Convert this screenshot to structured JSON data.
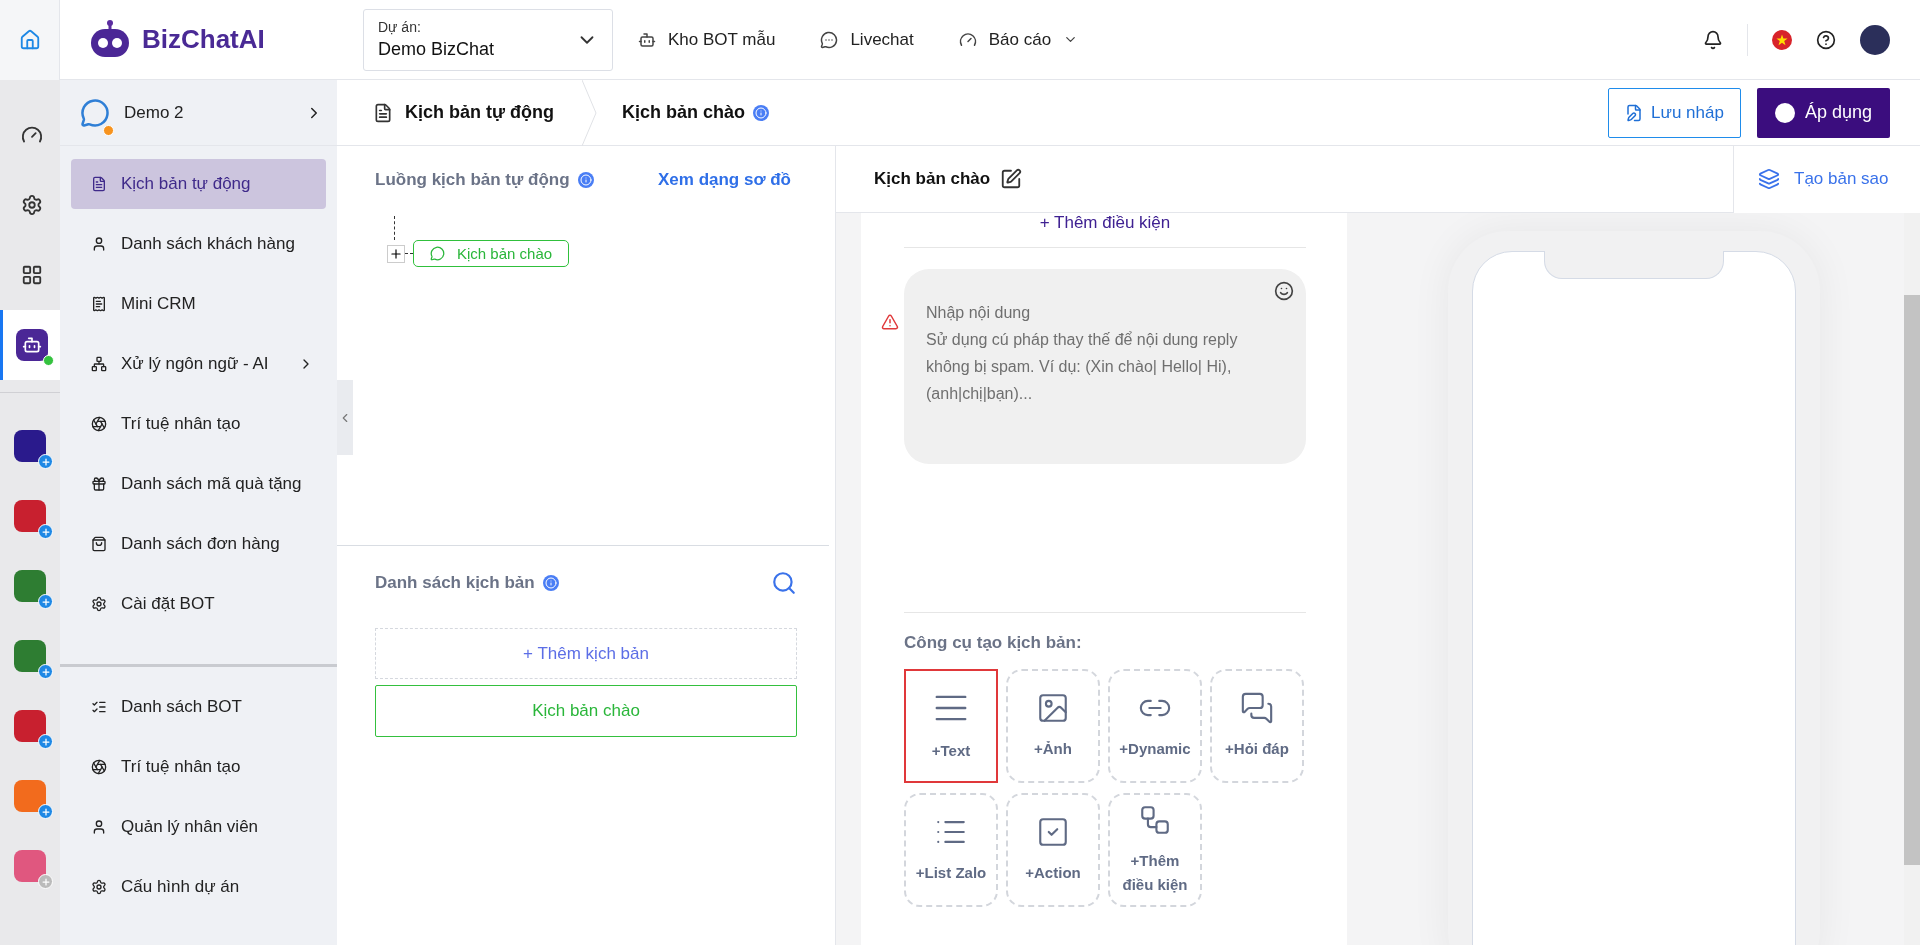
{
  "topbar": {
    "brand": "BizChatAI",
    "project": {
      "label": "Dự án:",
      "value": "Demo BizChat"
    },
    "nav": [
      {
        "label": "Kho BOT mẫu",
        "dropdown": false
      },
      {
        "label": "Livechat",
        "dropdown": false
      },
      {
        "label": "Báo cáo",
        "dropdown": true
      }
    ]
  },
  "rail": {
    "tools": [
      {
        "selected": false
      },
      {
        "selected": false
      },
      {
        "selected": false
      }
    ],
    "bot": {
      "selected": true,
      "online": true
    },
    "apps": [
      {
        "color": "#2a1a8c",
        "installed": false
      },
      {
        "color": "#c8202f",
        "installed": false
      },
      {
        "color": "#2e7d32",
        "installed": false
      },
      {
        "color": "#2e7d32",
        "installed": false
      },
      {
        "color": "#c8202f",
        "installed": false
      },
      {
        "color": "#f26b1d",
        "installed": false
      },
      {
        "color": "#e0577f",
        "installed": true
      }
    ]
  },
  "sidebar": {
    "bot_name": "Demo 2",
    "items": [
      {
        "label": "Kịch bản tự động",
        "selected": true,
        "submenu": false
      },
      {
        "label": "Danh sách khách hàng",
        "selected": false,
        "submenu": false
      },
      {
        "label": "Mini CRM",
        "selected": false,
        "submenu": false
      },
      {
        "label": "Xử lý ngôn ngữ - AI",
        "selected": false,
        "submenu": true
      },
      {
        "label": "Trí tuệ nhân tạo",
        "selected": false,
        "submenu": false
      },
      {
        "label": "Danh sách mã quà tặng",
        "selected": false,
        "submenu": false
      },
      {
        "label": "Danh sách đơn hàng",
        "selected": false,
        "submenu": false
      },
      {
        "label": "Cài đặt BOT",
        "selected": false,
        "submenu": false
      }
    ],
    "bottom_items": [
      {
        "label": "Danh sách BOT"
      },
      {
        "label": "Trí tuệ nhân tạo"
      },
      {
        "label": "Quản lý nhân viên"
      },
      {
        "label": "Cấu hình dự án"
      }
    ]
  },
  "breadcrumb": {
    "root": "Kịch bản tự động",
    "current": "Kịch bản chào"
  },
  "actions": {
    "draft": "Lưu nháp",
    "apply": "Áp dụng"
  },
  "flow": {
    "title": "Luồng kịch bản tự động",
    "view_diagram": "Xem dạng sơ đồ",
    "node": "Kịch bản chào"
  },
  "scripts": {
    "title": "Danh sách kịch bản",
    "add": "+ Thêm kịch bản",
    "items": [
      {
        "label": "Kịch bản chào",
        "selected": true
      }
    ]
  },
  "editor": {
    "title": "Kịch bản chào",
    "copy": "Tạo bản sao",
    "add_condition": "+ Thêm điều kiện",
    "message": {
      "placeholder": "Nhập nội dung\nSử dụng cú pháp thay thế để nội dung reply không bị spam. Ví dụ: (Xin chào| Hello| Hi), (anh|chị|bạn)...",
      "warning": true
    },
    "tools_title": "Công cụ tạo kịch bản:",
    "tools": [
      {
        "label": "+Text",
        "selected": true
      },
      {
        "label": "+Ảnh",
        "selected": false
      },
      {
        "label": "+Dynamic",
        "selected": false
      },
      {
        "label": "+Hỏi đáp",
        "selected": false
      },
      {
        "label": "+List Zalo",
        "selected": false
      },
      {
        "label": "+Action",
        "selected": false
      },
      {
        "label": "+Thêm điều kiện",
        "selected": false
      }
    ]
  }
}
